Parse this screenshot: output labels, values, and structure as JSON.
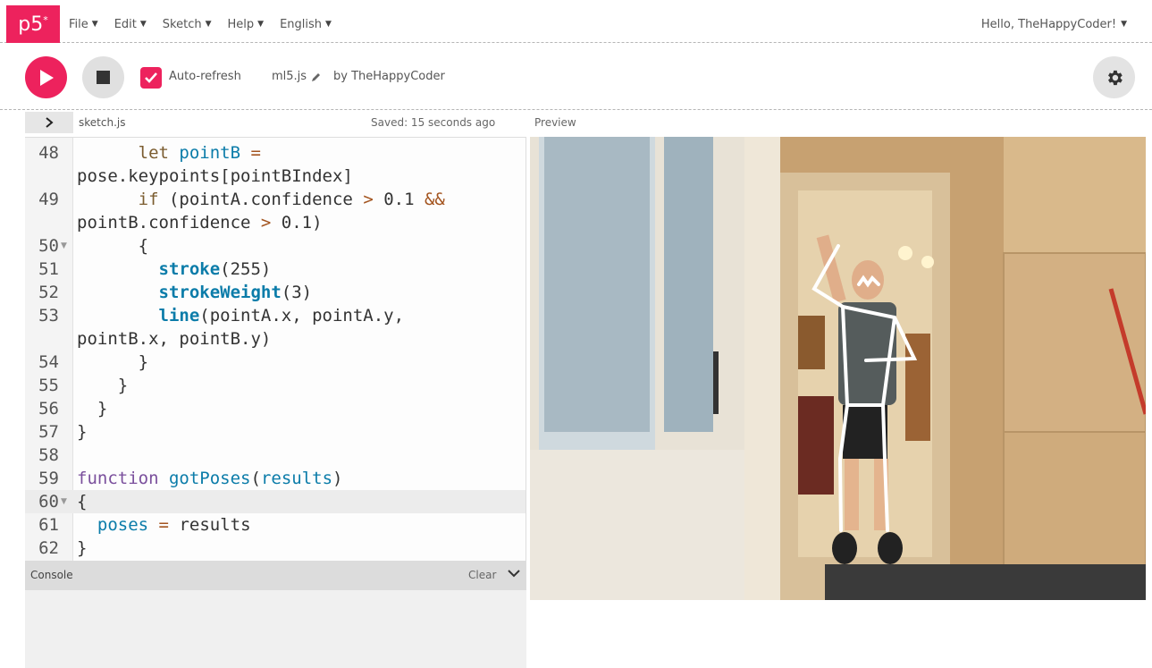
{
  "nav": {
    "logo": "p5",
    "logo_sup": "*",
    "menu": [
      {
        "label": "File"
      },
      {
        "label": "Edit"
      },
      {
        "label": "Sketch"
      },
      {
        "label": "Help"
      },
      {
        "label": "English"
      }
    ],
    "user_greeting": "Hello, TheHappyCoder!"
  },
  "toolbar": {
    "auto_refresh_label": "Auto-refresh",
    "auto_refresh_checked": true,
    "project_name": "ml5.js",
    "owner": "by TheHappyCoder"
  },
  "editor": {
    "file_name": "sketch.js",
    "saved_status": "Saved: 15 seconds ago",
    "preview_label": "Preview",
    "lines": [
      {
        "n": "48",
        "fold": false
      },
      {
        "n": "",
        "fold": false
      },
      {
        "n": "49",
        "fold": false
      },
      {
        "n": "",
        "fold": false
      },
      {
        "n": "50",
        "fold": true
      },
      {
        "n": "51",
        "fold": false
      },
      {
        "n": "52",
        "fold": false
      },
      {
        "n": "53",
        "fold": false
      },
      {
        "n": "",
        "fold": false
      },
      {
        "n": "54",
        "fold": false
      },
      {
        "n": "55",
        "fold": false
      },
      {
        "n": "56",
        "fold": false
      },
      {
        "n": "57",
        "fold": false
      },
      {
        "n": "58",
        "fold": false
      },
      {
        "n": "59",
        "fold": false
      },
      {
        "n": "60",
        "fold": true
      },
      {
        "n": "61",
        "fold": false
      },
      {
        "n": "62",
        "fold": false
      }
    ],
    "active_line": "60"
  },
  "console": {
    "label": "Console",
    "clear_label": "Clear"
  },
  "colors": {
    "accent": "#ed225d",
    "code_keyword": "#7a4f9c",
    "code_function": "#0b7ca9"
  }
}
